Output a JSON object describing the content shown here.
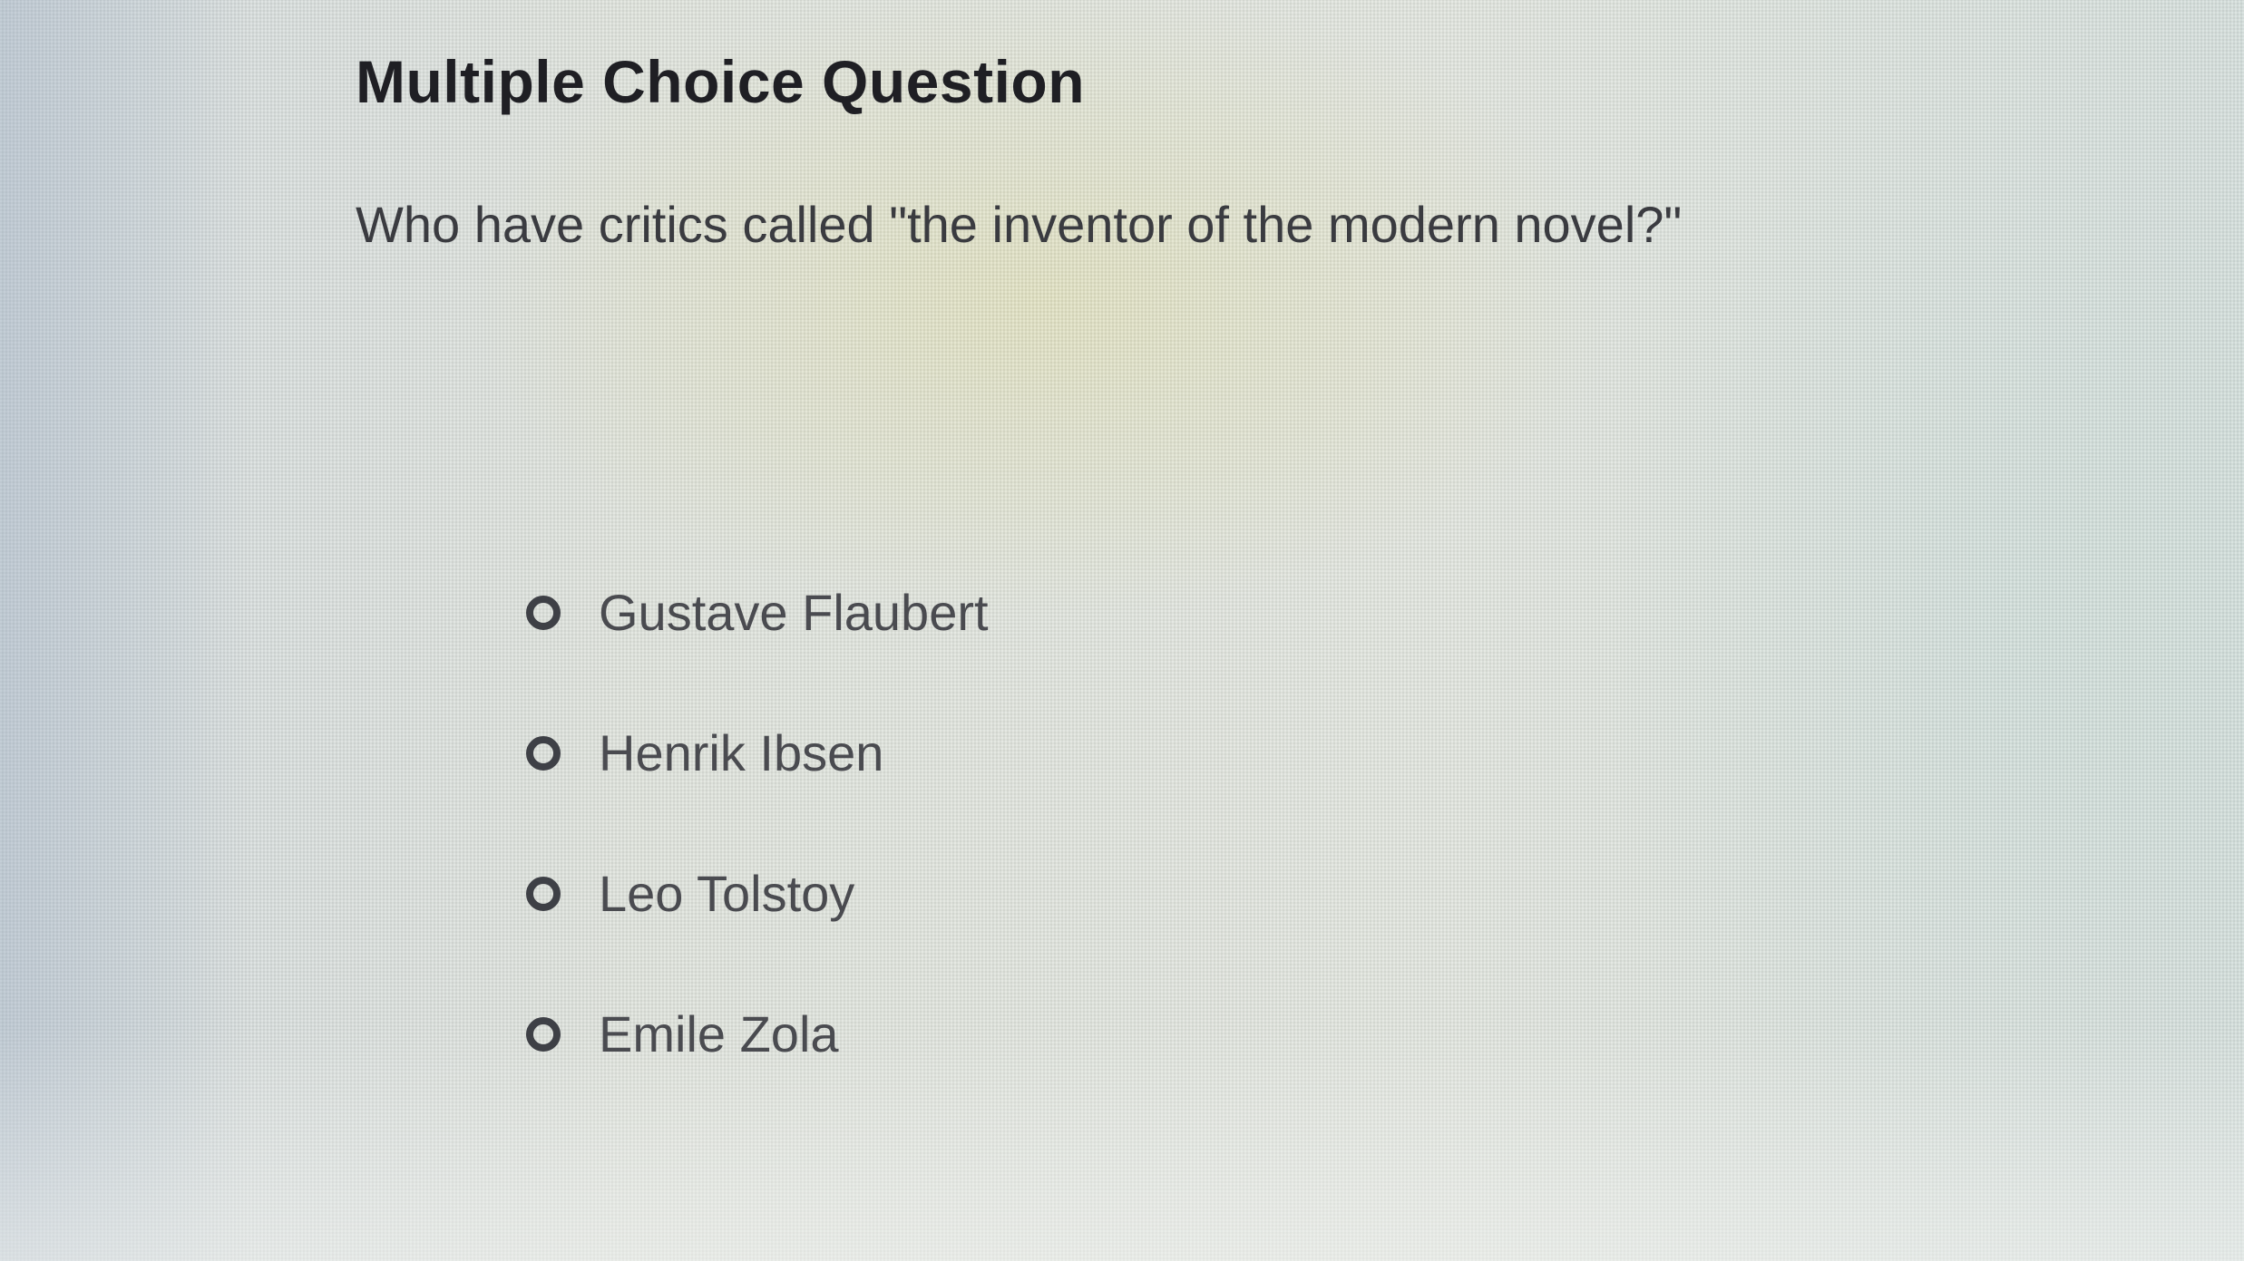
{
  "question": {
    "heading": "Multiple Choice Question",
    "prompt": "Who have critics called \"the inventor of the modern novel?\"",
    "options": [
      {
        "label": "Gustave Flaubert",
        "selected": false
      },
      {
        "label": "Henrik Ibsen",
        "selected": false
      },
      {
        "label": "Leo Tolstoy",
        "selected": false
      },
      {
        "label": "Emile Zola",
        "selected": false
      }
    ]
  },
  "colors": {
    "heading": "#1f1f24",
    "text": "#3a3b40",
    "radio_border": "#3e4046",
    "background": "#dfe3dc"
  },
  "icons": {
    "radio_unselected": "radio-unselected-icon"
  }
}
